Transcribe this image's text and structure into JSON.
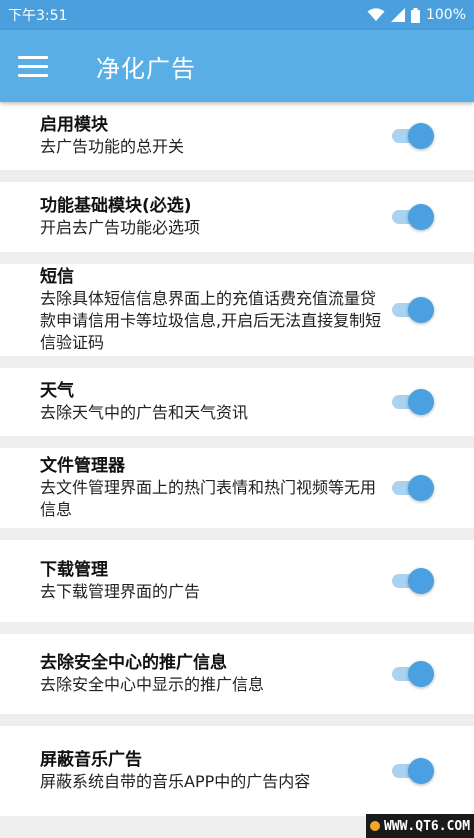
{
  "status_bar": {
    "time": "下午3:51",
    "battery": "100%",
    "icons": [
      "wifi-icon",
      "signal-icon",
      "battery-icon"
    ]
  },
  "app_bar": {
    "title": "净化广告",
    "menu_icon": "menu-icon"
  },
  "settings": [
    {
      "title": "启用模块",
      "desc": "去广告功能的总开关",
      "enabled": true
    },
    {
      "title": "功能基础模块(必选)",
      "desc": "开启去广告功能必选项",
      "enabled": true
    },
    {
      "title": "短信",
      "desc": "去除具体短信信息界面上的充值话费充值流量贷款申请信用卡等垃圾信息,开启后无法直接复制短信验证码",
      "enabled": true
    },
    {
      "title": "天气",
      "desc": "去除天气中的广告和天气资讯",
      "enabled": true
    },
    {
      "title": "文件管理器",
      "desc": "去文件管理界面上的热门表情和热门视频等无用信息",
      "enabled": true
    },
    {
      "title": "下载管理",
      "desc": "去下载管理界面的广告",
      "enabled": true
    },
    {
      "title": "去除安全中心的推广信息",
      "desc": "去除安全中心中显示的推广信息",
      "enabled": true
    },
    {
      "title": "屏蔽音乐广告",
      "desc": "屏蔽系统自带的音乐APP中的广告内容",
      "enabled": true
    }
  ],
  "watermark": "WWW.QT6.COM",
  "colors": {
    "status_bar": "#4a9fdc",
    "app_bar": "#5aaee6",
    "toggle_thumb": "#4aa0e0",
    "toggle_track": "#a9d3f1"
  }
}
